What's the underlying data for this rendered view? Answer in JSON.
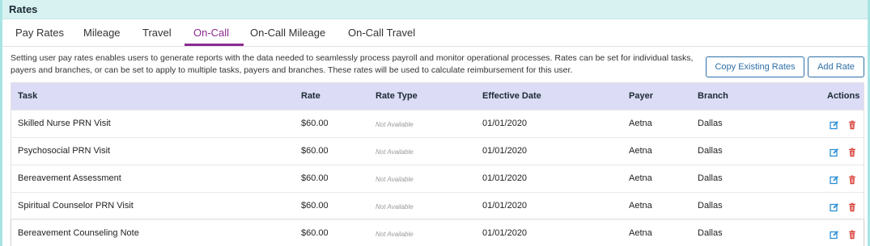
{
  "panel": {
    "title": "Rates"
  },
  "tabs": [
    {
      "label": "Pay Rates"
    },
    {
      "label": "Mileage"
    },
    {
      "label": "Travel"
    },
    {
      "label": "On-Call"
    },
    {
      "label": "On-Call Mileage"
    },
    {
      "label": "On-Call Travel"
    }
  ],
  "active_tab": "On-Call",
  "description": "Setting user pay rates enables users to generate reports with the data needed to seamlessly process payroll and monitor operational processes. Rates can be set for individual tasks, payers and branches, or can be set to apply to multiple tasks, payers and branches. These rates will be used to calculate reimbursement for this user.",
  "buttons": {
    "copy": "Copy Existing Rates",
    "add": "Add Rate"
  },
  "table": {
    "headers": {
      "task": "Task",
      "rate": "Rate",
      "rate_type": "Rate Type",
      "effective_date": "Effective Date",
      "payer": "Payer",
      "branch": "Branch",
      "actions": "Actions"
    },
    "rows": [
      {
        "task": "Skilled Nurse PRN Visit",
        "rate": "$60.00",
        "rate_type": "Not Available",
        "effective_date": "01/01/2020",
        "payer": "Aetna",
        "branch": "Dallas"
      },
      {
        "task": "Psychosocial PRN Visit",
        "rate": "$60.00",
        "rate_type": "Not Available",
        "effective_date": "01/01/2020",
        "payer": "Aetna",
        "branch": "Dallas"
      },
      {
        "task": "Bereavement Assessment",
        "rate": "$60.00",
        "rate_type": "Not Available",
        "effective_date": "01/01/2020",
        "payer": "Aetna",
        "branch": "Dallas"
      },
      {
        "task": "Spiritual Counselor PRN Visit",
        "rate": "$60.00",
        "rate_type": "Not Available",
        "effective_date": "01/01/2020",
        "payer": "Aetna",
        "branch": "Dallas"
      },
      {
        "task": "Bereavement Counseling Note",
        "rate": "$60.00",
        "rate_type": "Not Available",
        "effective_date": "01/01/2020",
        "payer": "Aetna",
        "branch": "Dallas"
      }
    ]
  },
  "icons": {
    "edit": "edit-icon",
    "delete": "trash-icon"
  },
  "colors": {
    "accent": "#8a2b8f",
    "button": "#2d6fa8",
    "header_bg": "#d8f2f2",
    "table_header_bg": "#dcdcf6",
    "edit_icon": "#2a8fd6",
    "delete_icon": "#d9413a"
  }
}
